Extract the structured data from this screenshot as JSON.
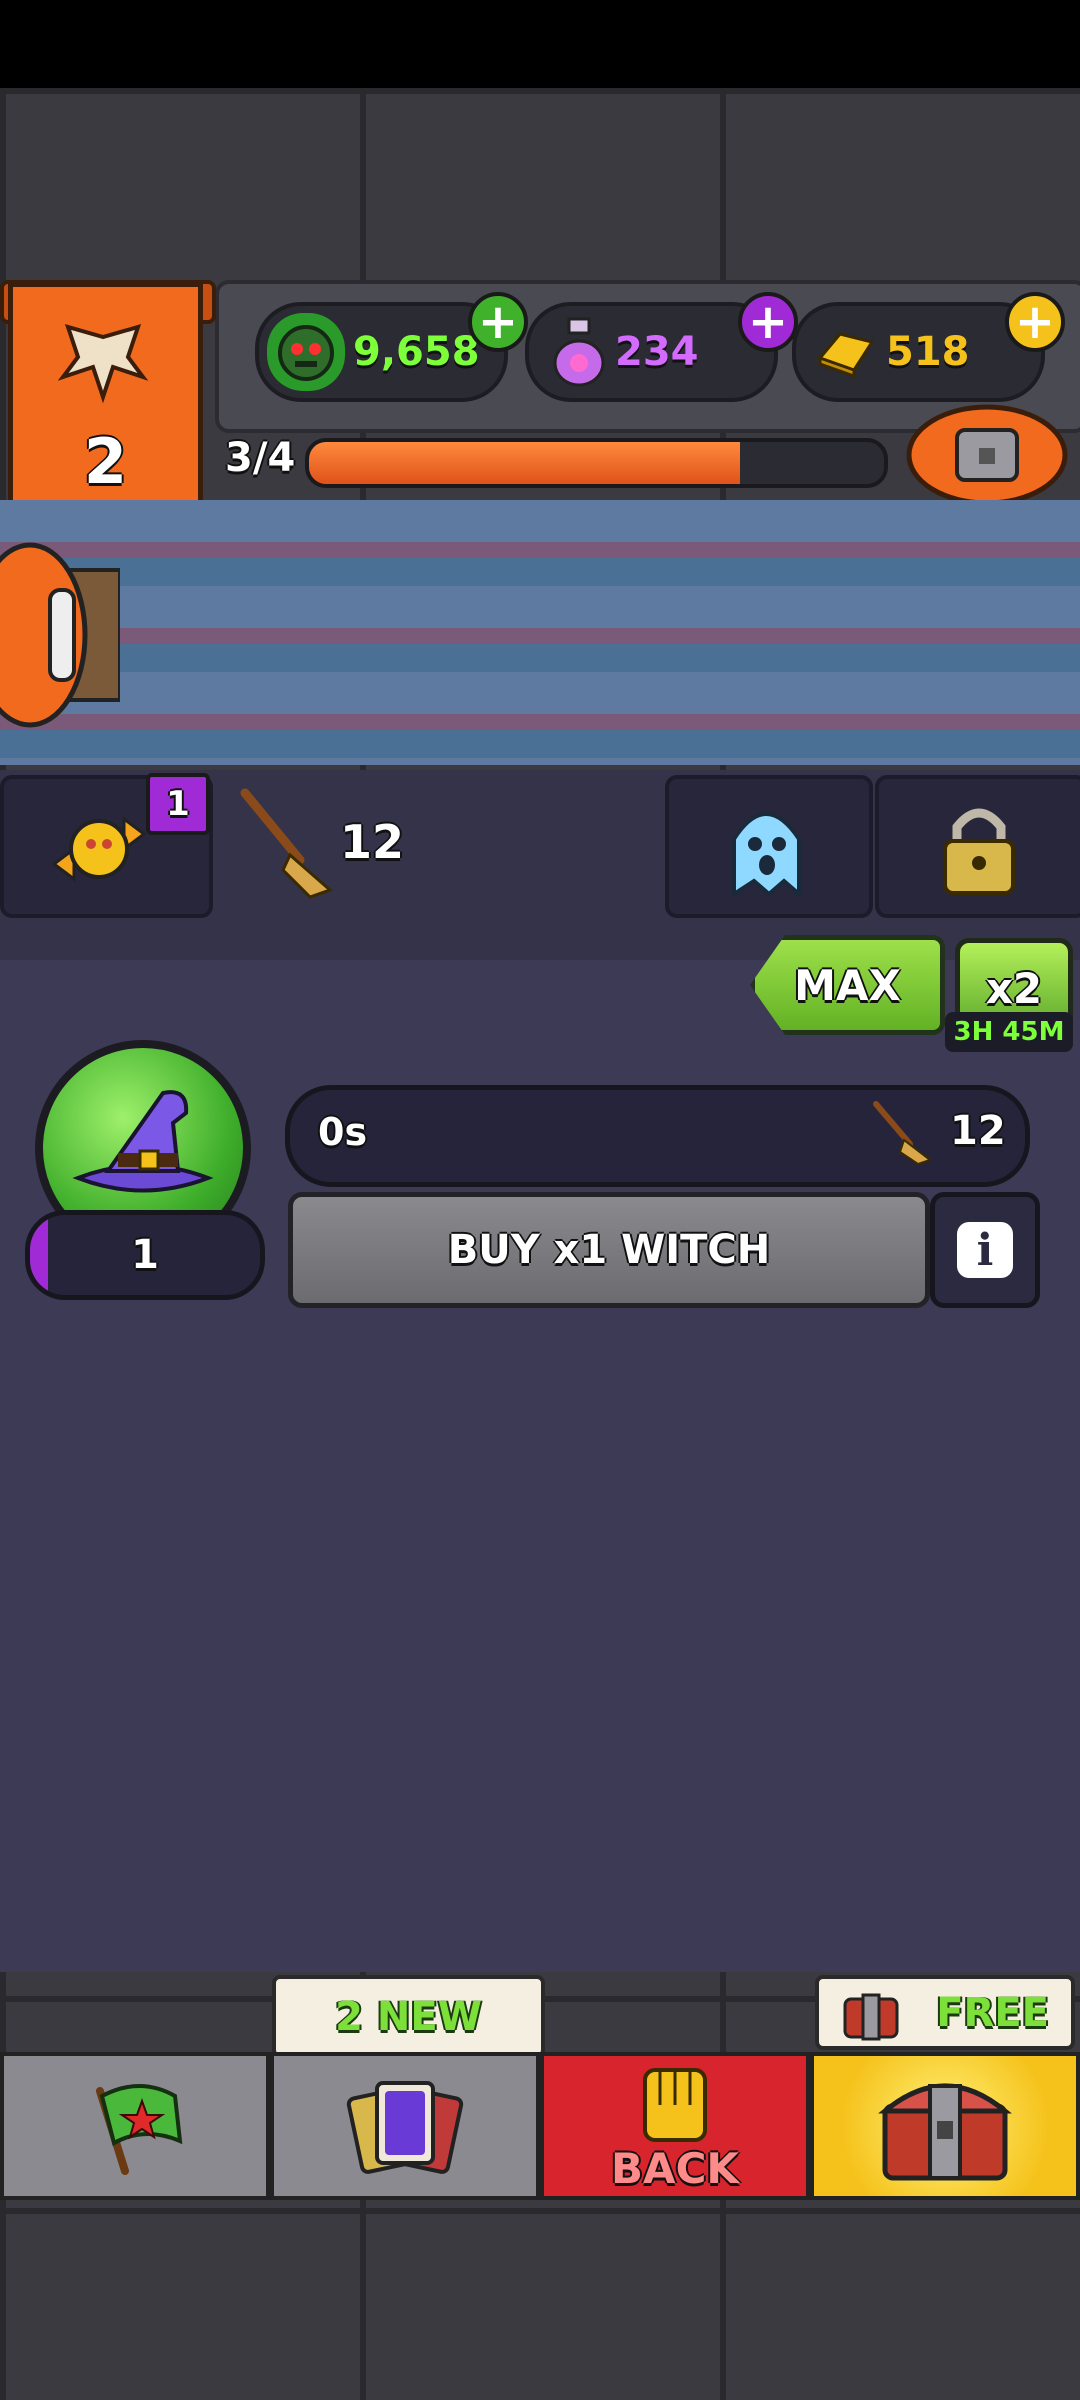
{
  "hud": {
    "level": "2",
    "slime_currency": "9,658",
    "potion_currency": "234",
    "gold_currency": "518",
    "wave_progress_label": "3/4",
    "wave_progress_fraction": 0.75
  },
  "tabs": {
    "candy_badge": "1",
    "broom_count": "12"
  },
  "upgrade": {
    "max_label": "MAX",
    "x2_label": "x2",
    "x2_timer": "3H 45M",
    "time_label": "0s",
    "cost_value": "12",
    "buy_label": "BUY x1 WITCH",
    "unit_level": "1",
    "info_label": "i"
  },
  "bottom_nav": {
    "cards_tag": "2 NEW",
    "back_label": "BACK",
    "chest_tag": "FREE"
  },
  "colors": {
    "orange": "#f26a1e",
    "green": "#62b225",
    "purple": "#a02bd6",
    "gold": "#f5c21b",
    "back_red": "#d8242c"
  }
}
